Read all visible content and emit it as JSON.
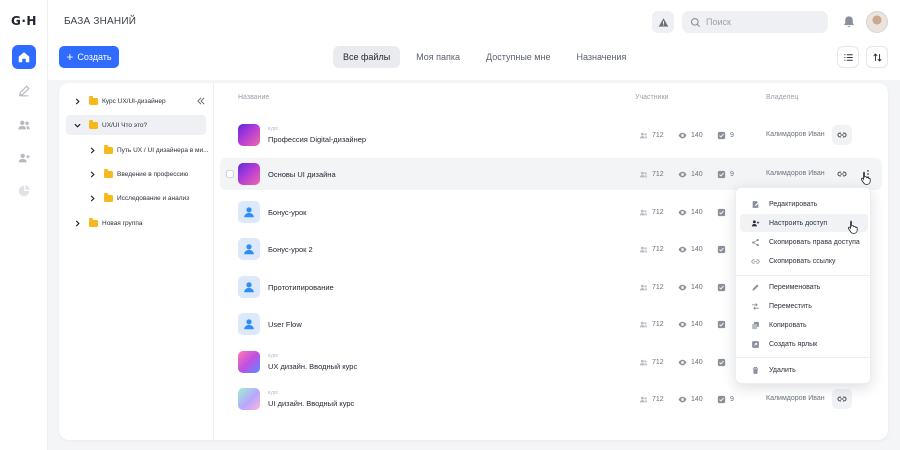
{
  "app": {
    "logo": "G·H",
    "page_title": "БАЗА ЗНАНИЙ"
  },
  "search": {
    "placeholder": "Поиск"
  },
  "toolbar": {
    "create_label": "Создать",
    "tabs": [
      {
        "label": "Все файлы",
        "active": true
      },
      {
        "label": "Моя папка",
        "active": false
      },
      {
        "label": "Доступные мне",
        "active": false
      },
      {
        "label": "Назначения",
        "active": false
      }
    ]
  },
  "tree": {
    "items": [
      {
        "label": "Курс UX/UI-дизайнер",
        "expanded": false
      },
      {
        "label": "UX/UI Что это?",
        "expanded": true,
        "selected": true
      },
      {
        "label": "Путь UX / UI дизайнера в ми...",
        "expanded": false
      },
      {
        "label": "Введение в профессию",
        "expanded": false
      },
      {
        "label": "Исследование и анализ",
        "expanded": false
      },
      {
        "label": "Новая группа",
        "expanded": false
      }
    ]
  },
  "table": {
    "columns": {
      "name": "Название",
      "participants": "Участники",
      "owner": "Владелец"
    },
    "rows": [
      {
        "tag": "курс",
        "name": "Профессия Digital-дизайнер",
        "participants": "712",
        "views": "140",
        "tasks": "9",
        "owner": "Калимдоров Иван",
        "thumb": "gradient-purple"
      },
      {
        "tag": "",
        "name": "Основы UI дизайна",
        "participants": "712",
        "views": "140",
        "tasks": "9",
        "owner": "Калимдоров Иван",
        "thumb": "gradient-purple"
      },
      {
        "tag": "",
        "name": "Бонус-урок",
        "participants": "712",
        "views": "140",
        "tasks": "",
        "owner": "",
        "thumb": "person"
      },
      {
        "tag": "",
        "name": "Бонус-урок 2",
        "participants": "712",
        "views": "140",
        "tasks": "",
        "owner": "",
        "thumb": "person"
      },
      {
        "tag": "",
        "name": "Прототипирование",
        "participants": "712",
        "views": "140",
        "tasks": "",
        "owner": "",
        "thumb": "person"
      },
      {
        "tag": "",
        "name": "User Flow",
        "participants": "712",
        "views": "140",
        "tasks": "",
        "owner": "",
        "thumb": "person"
      },
      {
        "tag": "курс",
        "name": "UX дизайн. Вводный курс",
        "participants": "712",
        "views": "140",
        "tasks": "",
        "owner": "",
        "thumb": "gradient-pink"
      },
      {
        "tag": "курс",
        "name": "UI дизайн. Вводный курс",
        "participants": "712",
        "views": "140",
        "tasks": "9",
        "owner": "Калимдоров Иван",
        "thumb": "gradient-mint"
      }
    ]
  },
  "context_menu": {
    "items": [
      {
        "label": "Редактировать",
        "icon": "edit-icon"
      },
      {
        "label": "Настроить доступ",
        "icon": "user-access-icon"
      },
      {
        "label": "Скопировать права доступа",
        "icon": "share-icon"
      },
      {
        "label": "Скопировать ссылку",
        "icon": "link-icon"
      },
      {
        "label": "Переименовать",
        "icon": "pencil-icon"
      },
      {
        "label": "Переместить",
        "icon": "move-icon"
      },
      {
        "label": "Копировать",
        "icon": "copy-icon"
      },
      {
        "label": "Создать ярлык",
        "icon": "shortcut-icon"
      },
      {
        "label": "Удалить",
        "icon": "trash-icon"
      }
    ]
  },
  "colors": {
    "accent": "#2f6bff",
    "folder": "#f6b81d",
    "background": "#f4f5f7"
  }
}
